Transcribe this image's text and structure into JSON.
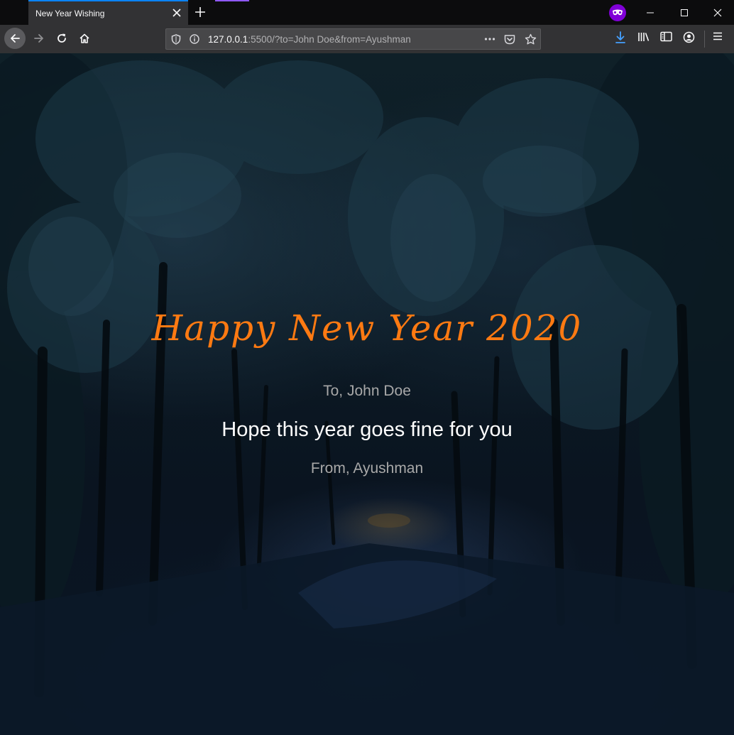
{
  "browser": {
    "tab": {
      "title": "New Year Wishing"
    },
    "url": {
      "host": "127.0.0.1",
      "rest": ":5500/?to=John Doe&from=Ayushman"
    },
    "colors": {
      "tab_accent": "#0a84ff",
      "private_badge": "#8000d7",
      "download_icon": "#45a1ff",
      "strip_accent": "#9059ff"
    }
  },
  "page": {
    "title": "Happy New Year 2020",
    "to_line": "To, John Doe",
    "message": "Hope this year goes fine for you",
    "from_line": "From, Ayushman",
    "colors": {
      "title": "#ff7a12",
      "message": "#ffffff",
      "secondary": "#a8a8a8"
    }
  }
}
